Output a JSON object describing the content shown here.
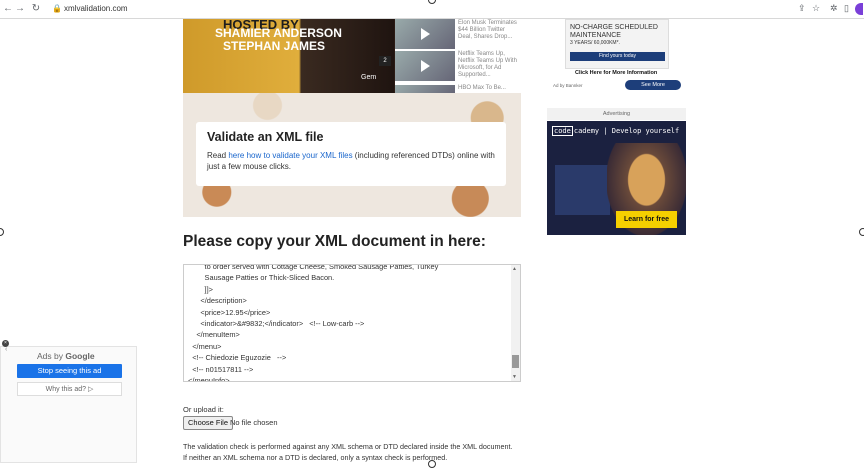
{
  "browser": {
    "url": "xmlvalidation.com",
    "back_icon": "←",
    "forward_icon": "→",
    "reload_icon": "↻"
  },
  "hero": {
    "line1": "HOSTED BY",
    "line2": "SHAMIER ANDERSON",
    "line3": "STEPHAN JAMES",
    "brand": "Gem",
    "page_badge": "2",
    "videos": [
      {
        "title": "Elon Musk Terminates $44 Billion Twitter Deal, Shares Drop..."
      },
      {
        "title": "Netflix Teams Up, Netflix Teams Up With Microsoft, for Ad Supported..."
      },
      {
        "title": "HBO Max To Be..."
      }
    ]
  },
  "card": {
    "title": "Validate an XML file",
    "text_prefix": "Read ",
    "link": "here how to validate your XML files",
    "text_suffix": " (including referenced DTDs) online with just a few mouse clicks."
  },
  "copy_heading": "Please copy your XML document in here:",
  "editor": {
    "lines": [
      "          to order served with Cottage Cheese, Smoked Sausage Patties, Turkey",
      "          Sausage Patties or Thick-Sliced Bacon.",
      "          ]]>",
      "        </description>",
      "        <price>12.95</price>",
      "        <indicator>&#9832;</indicator>   <!-- Low-carb -->",
      "      </menuItem>",
      "    </menu>",
      "    <!-- Chiedozie Eguzozie   -->",
      "    <!-- n01517811 -->",
      "  </menuInfo>"
    ]
  },
  "upload": {
    "label": "Or upload it:",
    "button": "Choose File",
    "status": "No file chosen"
  },
  "info": {
    "line1": "The validation check is performed against any XML schema or DTD declared inside the XML document.",
    "line2": "If neither an XML schema nor a DTD is declared, only a syntax check is performed."
  },
  "ad_top": {
    "headline": "NO-CHARGE SCHEDULED MAINTENANCE",
    "sub": "3 YEARS/ 60,000KM*.",
    "button": "Find yours today",
    "click": "Click Here for More Information",
    "byline": "Ad by Bannker",
    "more": "See More"
  },
  "advertising_label": "Advertising",
  "ad_codecademy": {
    "brand_code": "code",
    "brand_rest": "cademy | Develop yourself",
    "cta": "Learn for free"
  },
  "google_ad": {
    "prefix": "Ads by ",
    "brand": "Google",
    "stop": "Stop seeing this ad",
    "why": "Why this ad? ▷"
  }
}
